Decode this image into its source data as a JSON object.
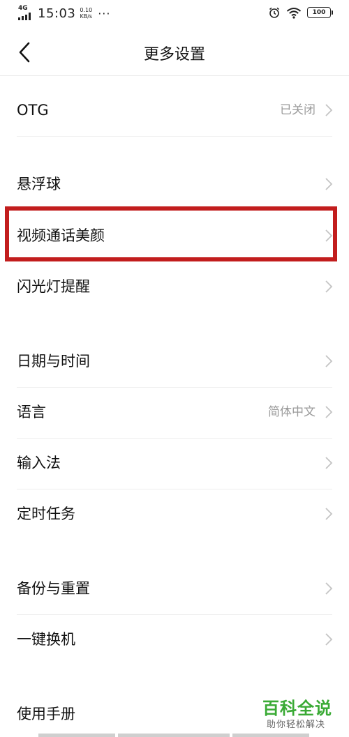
{
  "status_bar": {
    "network": "4G",
    "time": "15:03",
    "speed_value": "0.10",
    "speed_unit": "KB/s",
    "more_dots": "···",
    "battery": "100"
  },
  "header": {
    "title": "更多设置"
  },
  "rows": [
    {
      "label": "OTG",
      "value": "已关闭"
    },
    {
      "label": "悬浮球",
      "value": ""
    },
    {
      "label": "视频通话美颜",
      "value": ""
    },
    {
      "label": "闪光灯提醒",
      "value": ""
    },
    {
      "label": "日期与时间",
      "value": ""
    },
    {
      "label": "语言",
      "value": "简体中文"
    },
    {
      "label": "输入法",
      "value": ""
    },
    {
      "label": "定时任务",
      "value": ""
    },
    {
      "label": "备份与重置",
      "value": ""
    },
    {
      "label": "一键换机",
      "value": ""
    },
    {
      "label": "使用手册",
      "value": ""
    }
  ],
  "highlight_color": "#c21d1d",
  "watermark": {
    "title": "百科全说",
    "subtitle": "助你轻松解决",
    "color": "#3aaa35"
  }
}
